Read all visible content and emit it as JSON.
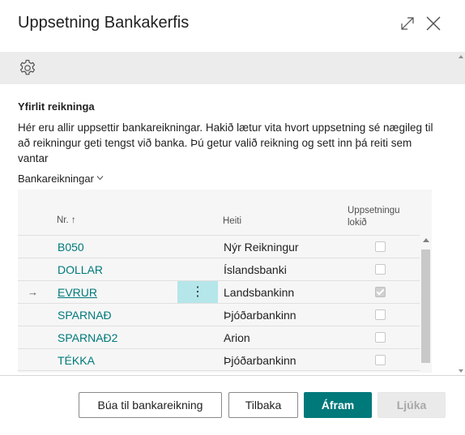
{
  "dialog": {
    "title": "Uppsetning Bankakerfis",
    "expand_icon": "expand-icon",
    "close_icon": "close-icon"
  },
  "toolbar": {
    "icon": "gear-icon"
  },
  "section": {
    "title": "Yfirlit reikninga",
    "description": "Hér eru allir uppsettir bankareikningar. Hakið lætur vita hvort uppsetning sé nægileg til að reikningur geti tengst við banka. Þú getur valið reikning og sett inn þá reiti sem vantar"
  },
  "grid": {
    "caption": "Bankareikningar",
    "columns": {
      "nr": "Nr.",
      "nr_sort": "↑",
      "heiti": "Heiti",
      "done": "Uppsetningu lokið"
    },
    "rows": [
      {
        "nr": "B050",
        "heiti": "Nýr Reikningur",
        "done": false,
        "current": false
      },
      {
        "nr": "DOLLAR",
        "heiti": "Íslandsbanki",
        "done": false,
        "current": false
      },
      {
        "nr": "EVRUR",
        "heiti": "Landsbankinn",
        "done": true,
        "current": true
      },
      {
        "nr": "SPARNAÐ",
        "heiti": "Þjóðarbankinn",
        "done": false,
        "current": false
      },
      {
        "nr": "SPARNAÐ2",
        "heiti": "Arion",
        "done": false,
        "current": false
      },
      {
        "nr": "TÉKKA",
        "heiti": "Þjóðarbankinn",
        "done": false,
        "current": false
      }
    ],
    "current_row_arrow": "→",
    "row_menu": "⋮"
  },
  "buttons": {
    "create": "Búa til bankareikning",
    "back": "Tilbaka",
    "next": "Áfram",
    "finish": "Ljúka"
  },
  "colors": {
    "accent": "#00797b",
    "selection": "#b5e6ea"
  }
}
